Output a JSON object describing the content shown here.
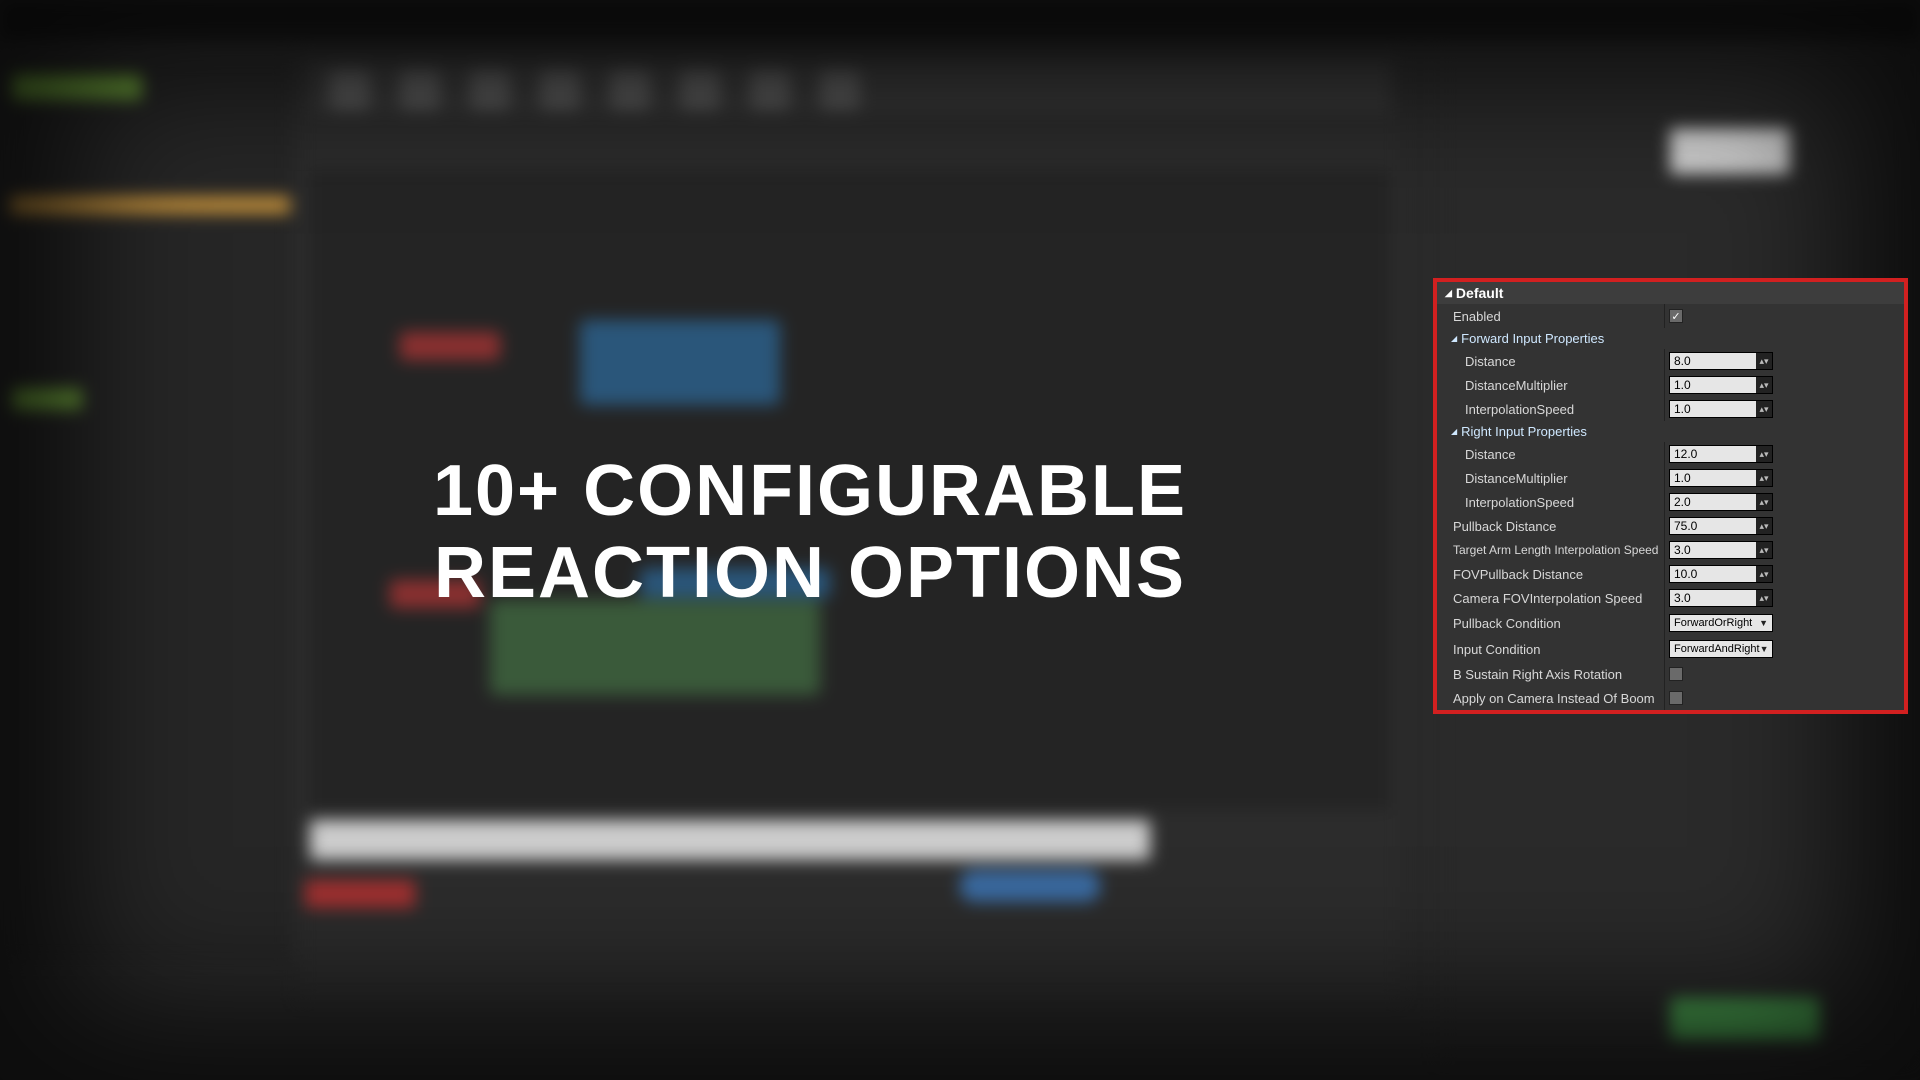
{
  "overlay": {
    "title": "10+ Configurable Reaction Options"
  },
  "panel": {
    "section_default": "Default",
    "enabled_label": "Enabled",
    "enabled_checked": true,
    "forward_header": "Forward Input Properties",
    "right_header": "Right Input Properties",
    "forward": {
      "distance_label": "Distance",
      "distance_value": "8.0",
      "multiplier_label": "DistanceMultiplier",
      "multiplier_value": "1.0",
      "interp_label": "InterpolationSpeed",
      "interp_value": "1.0"
    },
    "right": {
      "distance_label": "Distance",
      "distance_value": "12.0",
      "multiplier_label": "DistanceMultiplier",
      "multiplier_value": "1.0",
      "interp_label": "InterpolationSpeed",
      "interp_value": "2.0"
    },
    "pullback_distance_label": "Pullback Distance",
    "pullback_distance_value": "75.0",
    "target_arm_label": "Target Arm Length Interpolation Speed",
    "target_arm_value": "3.0",
    "fov_pullback_label": "FOVPullback Distance",
    "fov_pullback_value": "10.0",
    "camera_fov_label": "Camera FOVInterpolation Speed",
    "camera_fov_value": "3.0",
    "pullback_condition_label": "Pullback Condition",
    "pullback_condition_value": "ForwardOrRight",
    "input_condition_label": "Input Condition",
    "input_condition_value": "ForwardAndRight",
    "sustain_label": "B Sustain Right Axis Rotation",
    "sustain_checked": false,
    "apply_camera_label": "Apply on Camera Instead Of Boom",
    "apply_camera_checked": false
  }
}
